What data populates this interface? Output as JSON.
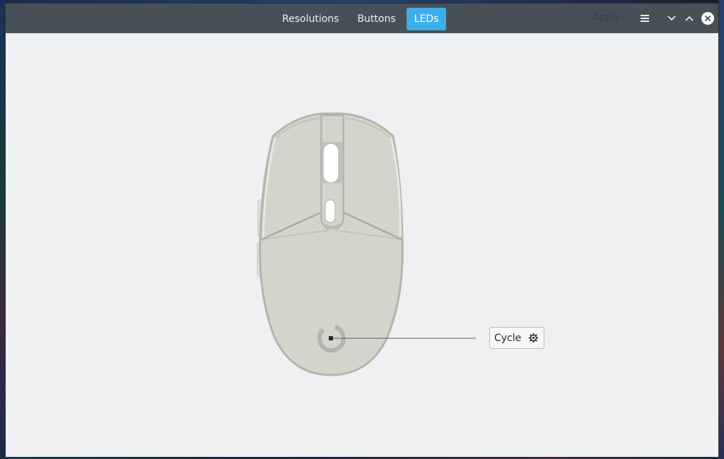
{
  "header": {
    "tabs": [
      {
        "label": "Resolutions",
        "active": false
      },
      {
        "label": "Buttons",
        "active": false
      },
      {
        "label": "LEDs",
        "active": true
      }
    ],
    "apply_label": "Apply",
    "icons": {
      "menu": "hamburger-menu-icon",
      "minimize": "chevron-down-icon",
      "maximize": "chevron-up-icon",
      "close": "close-circle-icon"
    }
  },
  "led": {
    "mode_label": "Cycle",
    "settings_icon": "gear-icon"
  },
  "colors": {
    "headerbar": "#475057",
    "accent": "#3daee9",
    "window_bg": "#eff0f1",
    "mouse_body": "#d4d4cc",
    "mouse_outline": "#b4b4ac"
  }
}
